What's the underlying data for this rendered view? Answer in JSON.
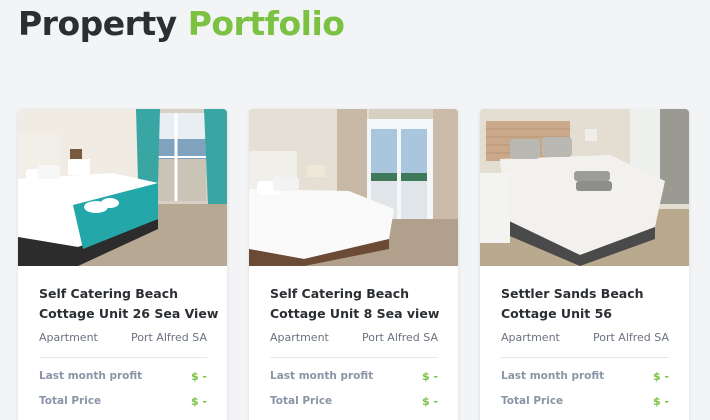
{
  "header": {
    "title_part1": "Property",
    "title_part2": "Portfolio"
  },
  "colors": {
    "accent": "#7cc242",
    "heading": "#2b2f33",
    "muted": "#8b95a7"
  },
  "labels": {
    "last_month_profit": "Last month profit",
    "total_price": "Total Price"
  },
  "properties": [
    {
      "title": "Self Catering Beach Cottage Unit 26 Sea View",
      "type": "Apartment",
      "location": "Port Alfred SA",
      "last_month_profit": "$ -",
      "total_price": "$ -",
      "photo_icon": "bedroom-photo-teal"
    },
    {
      "title": "Self Catering Beach Cottage Unit 8 Sea view",
      "type": "Apartment",
      "location": "Port Alfred SA",
      "last_month_profit": "$ -",
      "total_price": "$ -",
      "photo_icon": "bedroom-photo-white"
    },
    {
      "title": "Settler Sands Beach Cottage Unit 56",
      "type": "Apartment",
      "location": "Port Alfred SA",
      "last_month_profit": "$ -",
      "total_price": "$ -",
      "photo_icon": "bedroom-photo-grey"
    }
  ]
}
